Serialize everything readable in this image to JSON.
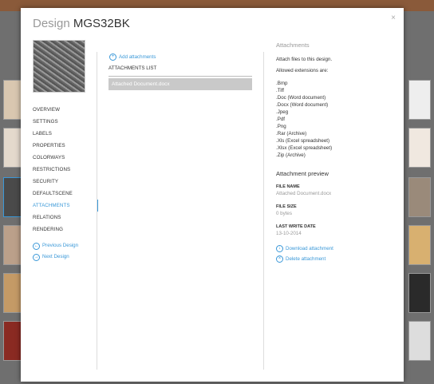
{
  "modal": {
    "title_prefix": "Design",
    "title_name": "MGS32BK",
    "close_label": "×"
  },
  "nav": {
    "items": [
      "OVERVIEW",
      "SETTINGS",
      "LABELS",
      "PROPERTIES",
      "COLORWAYS",
      "RESTRICTIONS",
      "SECURITY",
      "DEFAULTSCENE",
      "ATTACHMENTS",
      "RELATIONS",
      "RENDERING"
    ],
    "active_index": 8,
    "prev_label": "Previous Design",
    "next_label": "Next Design"
  },
  "attachments_list": {
    "add_label": "Add attachments",
    "header": "ATTACHMENTS LIST",
    "items": [
      "Attached Document.docx"
    ]
  },
  "info": {
    "heading": "Attachments",
    "intro": "Attach files to this design.",
    "allowed_title": "Allowed extensions are:",
    "extensions": [
      ".Bmp",
      ".Tiff",
      ".Doc (Word document)",
      ".Docx (Word document)",
      ".Jpeg",
      ".Pdf",
      ".Png",
      ".Rar (Archive)",
      ".Xls (Excel spreadsheet)",
      ".Xlsx (Excel spreadsheet)",
      ".Zip (Archive)"
    ]
  },
  "preview": {
    "heading": "Attachment preview",
    "file_name_label": "FILE NAME",
    "file_name": "Attached Document.docx",
    "file_size_label": "FILE SIZE",
    "file_size": "0 bytes",
    "last_write_label": "LAST WRITE DATE",
    "last_write": "13-10-2014",
    "download_label": "Download attachment",
    "delete_label": "Delete attachment"
  },
  "colors": {
    "accent": "#3a98d8"
  }
}
